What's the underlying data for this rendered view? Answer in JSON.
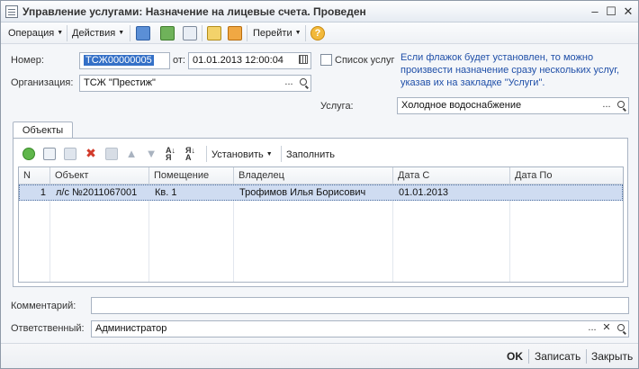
{
  "window": {
    "title": "Управление услугами: Назначение на лицевые счета. Проведен",
    "minimize": "–",
    "maximize": "☐",
    "close": "✕"
  },
  "toolbar": {
    "operation": "Операция",
    "actions": "Действия",
    "goto": "Перейти",
    "help": "?"
  },
  "form": {
    "number_label": "Номер:",
    "number_value": "ТСЖ00000005",
    "date_label": "от:",
    "date_value": "01.01.2013 12:00:04",
    "services_list_label": "Список услуг",
    "hint": [
      "Если флажок будет установлен, то можно",
      "произвести назначение сразу нескольких услуг,",
      "указав их на закладке \"Услуги\"."
    ],
    "org_label": "Организация:",
    "org_value": "ТСЖ \"Престиж\"",
    "service_label": "Услуга:",
    "service_value": "Холодное водоснабжение",
    "comment_label": "Комментарий:",
    "comment_value": "",
    "responsible_label": "Ответственный:",
    "responsible_value": "Администратор"
  },
  "tab": {
    "label": "Объекты"
  },
  "grid_toolbar": {
    "set": "Установить",
    "fill": "Заполнить"
  },
  "table": {
    "columns": [
      "N",
      "Объект",
      "Помещение",
      "Владелец",
      "Дата С",
      "Дата По"
    ],
    "rows": [
      {
        "n": "1",
        "object": "л/с №2011067001",
        "room": "Кв. 1",
        "owner": "Трофимов Илья Борисович",
        "date_from": "01.01.2013",
        "date_to": ""
      }
    ]
  },
  "footer": {
    "ok": "OK",
    "save": "Записать",
    "close": "Закрыть"
  }
}
